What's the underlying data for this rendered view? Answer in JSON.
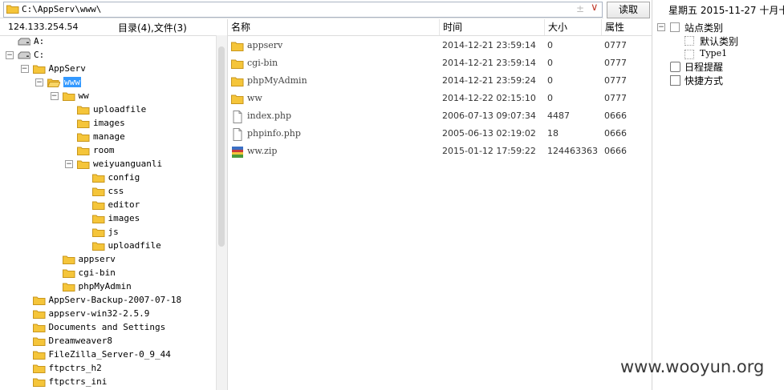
{
  "path_bar": {
    "path": "C:\\AppServ\\www\\",
    "plus_glyph": "±",
    "drop_glyph": "∨",
    "read_button": "读取"
  },
  "left_header": {
    "ip": "124.133.254.54",
    "dir_count": "目录(4),文件(3)"
  },
  "tree": [
    {
      "label": "A:",
      "level": 0,
      "icon": "drive-icon",
      "expander": ""
    },
    {
      "label": "C:",
      "level": 0,
      "icon": "drive-icon",
      "expander": "−"
    },
    {
      "label": "AppServ",
      "level": 1,
      "icon": "folder-icon",
      "expander": "−"
    },
    {
      "label": "www",
      "level": 2,
      "icon": "folder-open-icon",
      "expander": "−",
      "selected": true
    },
    {
      "label": "ww",
      "level": 3,
      "icon": "folder-icon",
      "expander": "−"
    },
    {
      "label": "uploadfile",
      "level": 4,
      "icon": "folder-icon",
      "expander": ""
    },
    {
      "label": "images",
      "level": 4,
      "icon": "folder-icon",
      "expander": ""
    },
    {
      "label": "manage",
      "level": 4,
      "icon": "folder-icon",
      "expander": ""
    },
    {
      "label": "room",
      "level": 4,
      "icon": "folder-icon",
      "expander": ""
    },
    {
      "label": "weiyuanguanli",
      "level": 4,
      "icon": "folder-icon",
      "expander": "−"
    },
    {
      "label": "config",
      "level": 5,
      "icon": "folder-icon",
      "expander": ""
    },
    {
      "label": "css",
      "level": 5,
      "icon": "folder-icon",
      "expander": ""
    },
    {
      "label": "editor",
      "level": 5,
      "icon": "folder-icon",
      "expander": ""
    },
    {
      "label": "images",
      "level": 5,
      "icon": "folder-icon",
      "expander": ""
    },
    {
      "label": "js",
      "level": 5,
      "icon": "folder-icon",
      "expander": ""
    },
    {
      "label": "uploadfile",
      "level": 5,
      "icon": "folder-icon",
      "expander": ""
    },
    {
      "label": "appserv",
      "level": 3,
      "icon": "folder-icon",
      "expander": ""
    },
    {
      "label": "cgi-bin",
      "level": 3,
      "icon": "folder-icon",
      "expander": ""
    },
    {
      "label": "phpMyAdmin",
      "level": 3,
      "icon": "folder-icon",
      "expander": ""
    },
    {
      "label": "AppServ-Backup-2007-07-18",
      "level": 1,
      "icon": "folder-icon",
      "expander": ""
    },
    {
      "label": "appserv-win32-2.5.9",
      "level": 1,
      "icon": "folder-icon",
      "expander": ""
    },
    {
      "label": "Documents and Settings",
      "level": 1,
      "icon": "folder-icon",
      "expander": ""
    },
    {
      "label": "Dreamweaver8",
      "level": 1,
      "icon": "folder-icon",
      "expander": ""
    },
    {
      "label": "FileZilla_Server-0_9_44",
      "level": 1,
      "icon": "folder-icon",
      "expander": ""
    },
    {
      "label": "ftpctrs_h2",
      "level": 1,
      "icon": "folder-icon",
      "expander": ""
    },
    {
      "label": "ftpctrs_ini",
      "level": 1,
      "icon": "folder-icon",
      "expander": ""
    }
  ],
  "file_list": {
    "columns": [
      "名称",
      "时间",
      "大小",
      "属性"
    ],
    "rows": [
      {
        "name": "appserv",
        "time": "2014-12-21 23:59:14",
        "size": "0",
        "attr": "0777",
        "icon": "folder-icon"
      },
      {
        "name": "cgi-bin",
        "time": "2014-12-21 23:59:14",
        "size": "0",
        "attr": "0777",
        "icon": "folder-icon"
      },
      {
        "name": "phpMyAdmin",
        "time": "2014-12-21 23:59:24",
        "size": "0",
        "attr": "0777",
        "icon": "folder-icon"
      },
      {
        "name": "ww",
        "time": "2014-12-22 02:15:10",
        "size": "0",
        "attr": "0777",
        "icon": "folder-icon"
      },
      {
        "name": "index.php",
        "time": "2006-07-13 09:07:34",
        "size": "4487",
        "attr": "0666",
        "icon": "file-icon"
      },
      {
        "name": "phpinfo.php",
        "time": "2005-06-13 02:19:02",
        "size": "18",
        "attr": "0666",
        "icon": "file-icon"
      },
      {
        "name": "ww.zip",
        "time": "2015-01-12 17:59:22",
        "size": "124463363",
        "attr": "0666",
        "icon": "archive-icon"
      }
    ]
  },
  "right_panel": {
    "date": "星期五  2015-11-27  十月十",
    "site_categories": "站点类别",
    "default_category": "默认类别",
    "type1": "Type1",
    "schedule": "日程提醒",
    "shortcuts": "快捷方式"
  },
  "watermark": "www.wooyun.org",
  "colors": {
    "folder": "#f5c53a",
    "folder_edge": "#c8961c",
    "selection": "#3399ff"
  }
}
